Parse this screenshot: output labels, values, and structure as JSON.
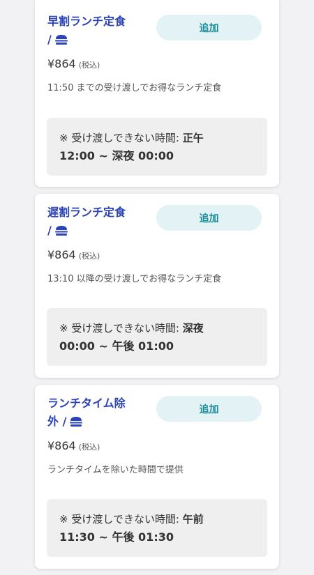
{
  "add_label": "追加",
  "icon": "burger-icon",
  "colors": {
    "title": "#2b43b5",
    "add_button_bg": "#e3f2f4",
    "add_button_text": "#188d98",
    "notice_bg": "#efefef"
  },
  "products": [
    {
      "title_line1": "早割ランチ定食",
      "title_line2": "/",
      "price": "¥864",
      "tax_note": "(税込)",
      "description": "11:50 までの受け渡しでお得なランチ定食",
      "unavailable_lead": "※ 受け渡しできない時間: ",
      "unavailable_period": "正午",
      "unavailable_range": "12:00 ~ 深夜 00:00"
    },
    {
      "title_line1": "遅割ランチ定食",
      "title_line2": "/",
      "price": "¥864",
      "tax_note": "(税込)",
      "description": "13:10 以降の受け渡しでお得なランチ定食",
      "unavailable_lead": "※ 受け渡しできない時間: ",
      "unavailable_period": "深夜",
      "unavailable_range": "00:00 ~ 午後 01:00"
    },
    {
      "title_line1": "ランチタイム除",
      "title_line2": "外 /",
      "price": "¥864",
      "tax_note": "(税込)",
      "description": "ランチタイムを除いた時間で提供",
      "unavailable_lead": "※ 受け渡しできない時間: ",
      "unavailable_period": "午前",
      "unavailable_range": "11:30 ~ 午後 01:30"
    }
  ]
}
